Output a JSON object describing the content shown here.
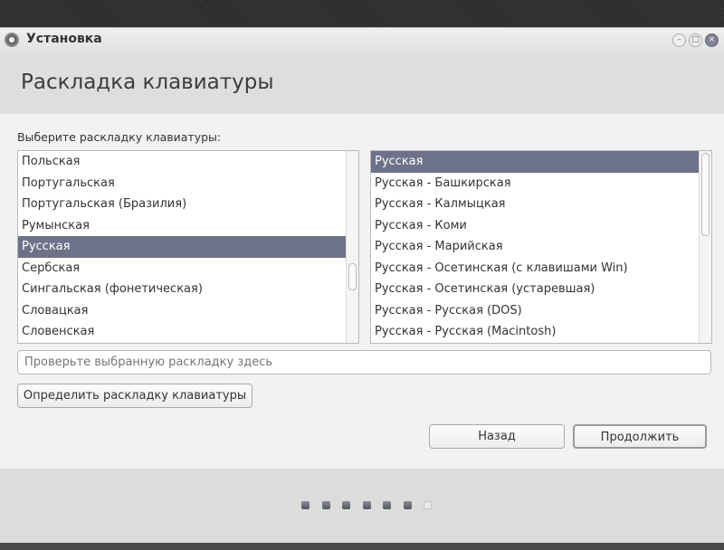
{
  "window": {
    "title": "Установка"
  },
  "header": {
    "title": "Раскладка клавиатуры"
  },
  "main": {
    "prompt": "Выберите раскладку клавиатуры:",
    "layouts": [
      {
        "label": "Польская",
        "selected": false
      },
      {
        "label": "Португальская",
        "selected": false
      },
      {
        "label": "Португальская (Бразилия)",
        "selected": false
      },
      {
        "label": "Румынская",
        "selected": false
      },
      {
        "label": "Русская",
        "selected": true
      },
      {
        "label": "Сербская",
        "selected": false
      },
      {
        "label": "Сингальская (фонетическая)",
        "selected": false
      },
      {
        "label": "Словацкая",
        "selected": false
      },
      {
        "label": "Словенская",
        "selected": false
      }
    ],
    "variants": [
      {
        "label": "Русская",
        "selected": true
      },
      {
        "label": "Русская - Башкирская",
        "selected": false
      },
      {
        "label": "Русская - Калмыцкая",
        "selected": false
      },
      {
        "label": "Русская - Коми",
        "selected": false
      },
      {
        "label": "Русская - Марийская",
        "selected": false
      },
      {
        "label": "Русская - Осетинская (с клавишами Win)",
        "selected": false
      },
      {
        "label": "Русская - Осетинская (устаревшая)",
        "selected": false
      },
      {
        "label": "Русская - Русская (DOS)",
        "selected": false
      },
      {
        "label": "Русская - Русская (Macintosh)",
        "selected": false
      }
    ],
    "test_input": {
      "placeholder": "Проверьте выбранную раскладку здесь",
      "value": ""
    },
    "detect_label": "Определить раскладку клавиатуры",
    "back_label": "Назад",
    "continue_label": "Продолжить"
  },
  "progress": {
    "total_steps": 7,
    "completed_steps": 6
  },
  "colors": {
    "selection": "#6e7289"
  }
}
